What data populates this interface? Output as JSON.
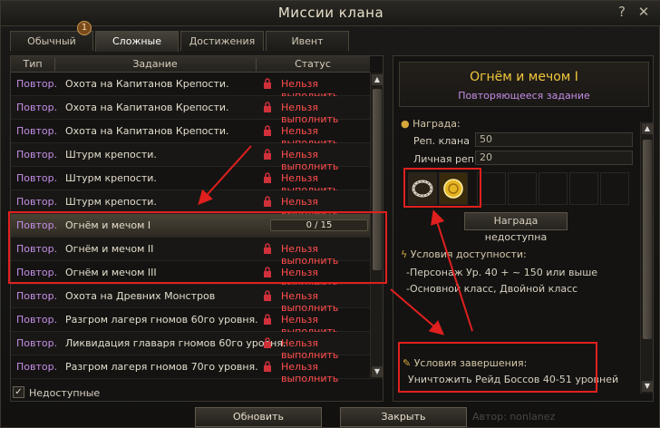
{
  "window": {
    "title": "Миссии клана"
  },
  "titlebar": {
    "help_glyph": "?",
    "close_glyph": "✕"
  },
  "tabs": [
    {
      "label": "Обычный",
      "badge": "1"
    },
    {
      "label": "Сложные"
    },
    {
      "label": "Достижения"
    },
    {
      "label": "Ивент"
    }
  ],
  "table": {
    "headers": {
      "type": "Тип",
      "task": "Задание",
      "status": "Статус"
    },
    "rows": [
      {
        "type": "Повтор.",
        "task": "Охота на Капитанов Крепости.",
        "status": "Нельзя выполнить"
      },
      {
        "type": "Повтор.",
        "task": "Охота на Капитанов Крепости.",
        "status": "Нельзя выполнить"
      },
      {
        "type": "Повтор.",
        "task": "Охота на Капитанов Крепости.",
        "status": "Нельзя выполнить"
      },
      {
        "type": "Повтор.",
        "task": "Штурм крепости.",
        "status": "Нельзя выполнить"
      },
      {
        "type": "Повтор.",
        "task": "Штурм крепости.",
        "status": "Нельзя выполнить"
      },
      {
        "type": "Повтор.",
        "task": "Штурм крепости.",
        "status": "Нельзя выполнить"
      },
      {
        "type": "Повтор.",
        "task": "Огнём и мечом I",
        "progress": "0 / 15",
        "progress_fraction": 0
      },
      {
        "type": "Повтор.",
        "task": "Огнём и мечом II",
        "status": "Нельзя выполнить"
      },
      {
        "type": "Повтор.",
        "task": "Огнём и мечом III",
        "status": "Нельзя выполнить"
      },
      {
        "type": "Повтор.",
        "task": "Охота на Древних Монстров",
        "status": "Нельзя выполнить"
      },
      {
        "type": "Повтор.",
        "task": "Разгром лагеря гномов 60го уровня.",
        "status": "Нельзя выполнить"
      },
      {
        "type": "Повтор.",
        "task": "Ликвидация главаря гномов 60го уровня.",
        "status": "Нельзя выполнить"
      },
      {
        "type": "Повтор.",
        "task": "Разгром лагеря гномов 70го уровня.",
        "status": "Нельзя выполнить"
      }
    ],
    "unavailable_label": "Недоступные",
    "unavailable_checked": true
  },
  "details": {
    "name": "Огнём и мечом I",
    "subtitle": "Повторяющееся задание",
    "reward_label": "Награда:",
    "clan_rep_label": "Реп. клана",
    "clan_rep_value": "50",
    "personal_rep_label": "Личная реп.",
    "personal_rep_value": "20",
    "reward_button": "Награда недоступна",
    "availability_label": "Условия доступности:",
    "availability_lines": [
      "-Персонаж Ур. 40  + ~ 150  или выше",
      "-Основной класс, Двойной класс"
    ],
    "completion_label": "Условия завершения:",
    "completion_text": "Уничтожить Рейд Боссов 40-51 уровней"
  },
  "buttons": {
    "refresh": "Обновить",
    "close": "Закрыть"
  },
  "footer_text": "Автор: nonlanez",
  "colors": {
    "accent_gold": "#f1c83b",
    "type_purple": "#c58ee6",
    "status_red": "#ff4d4d",
    "annotation_red": "#e0201e"
  }
}
